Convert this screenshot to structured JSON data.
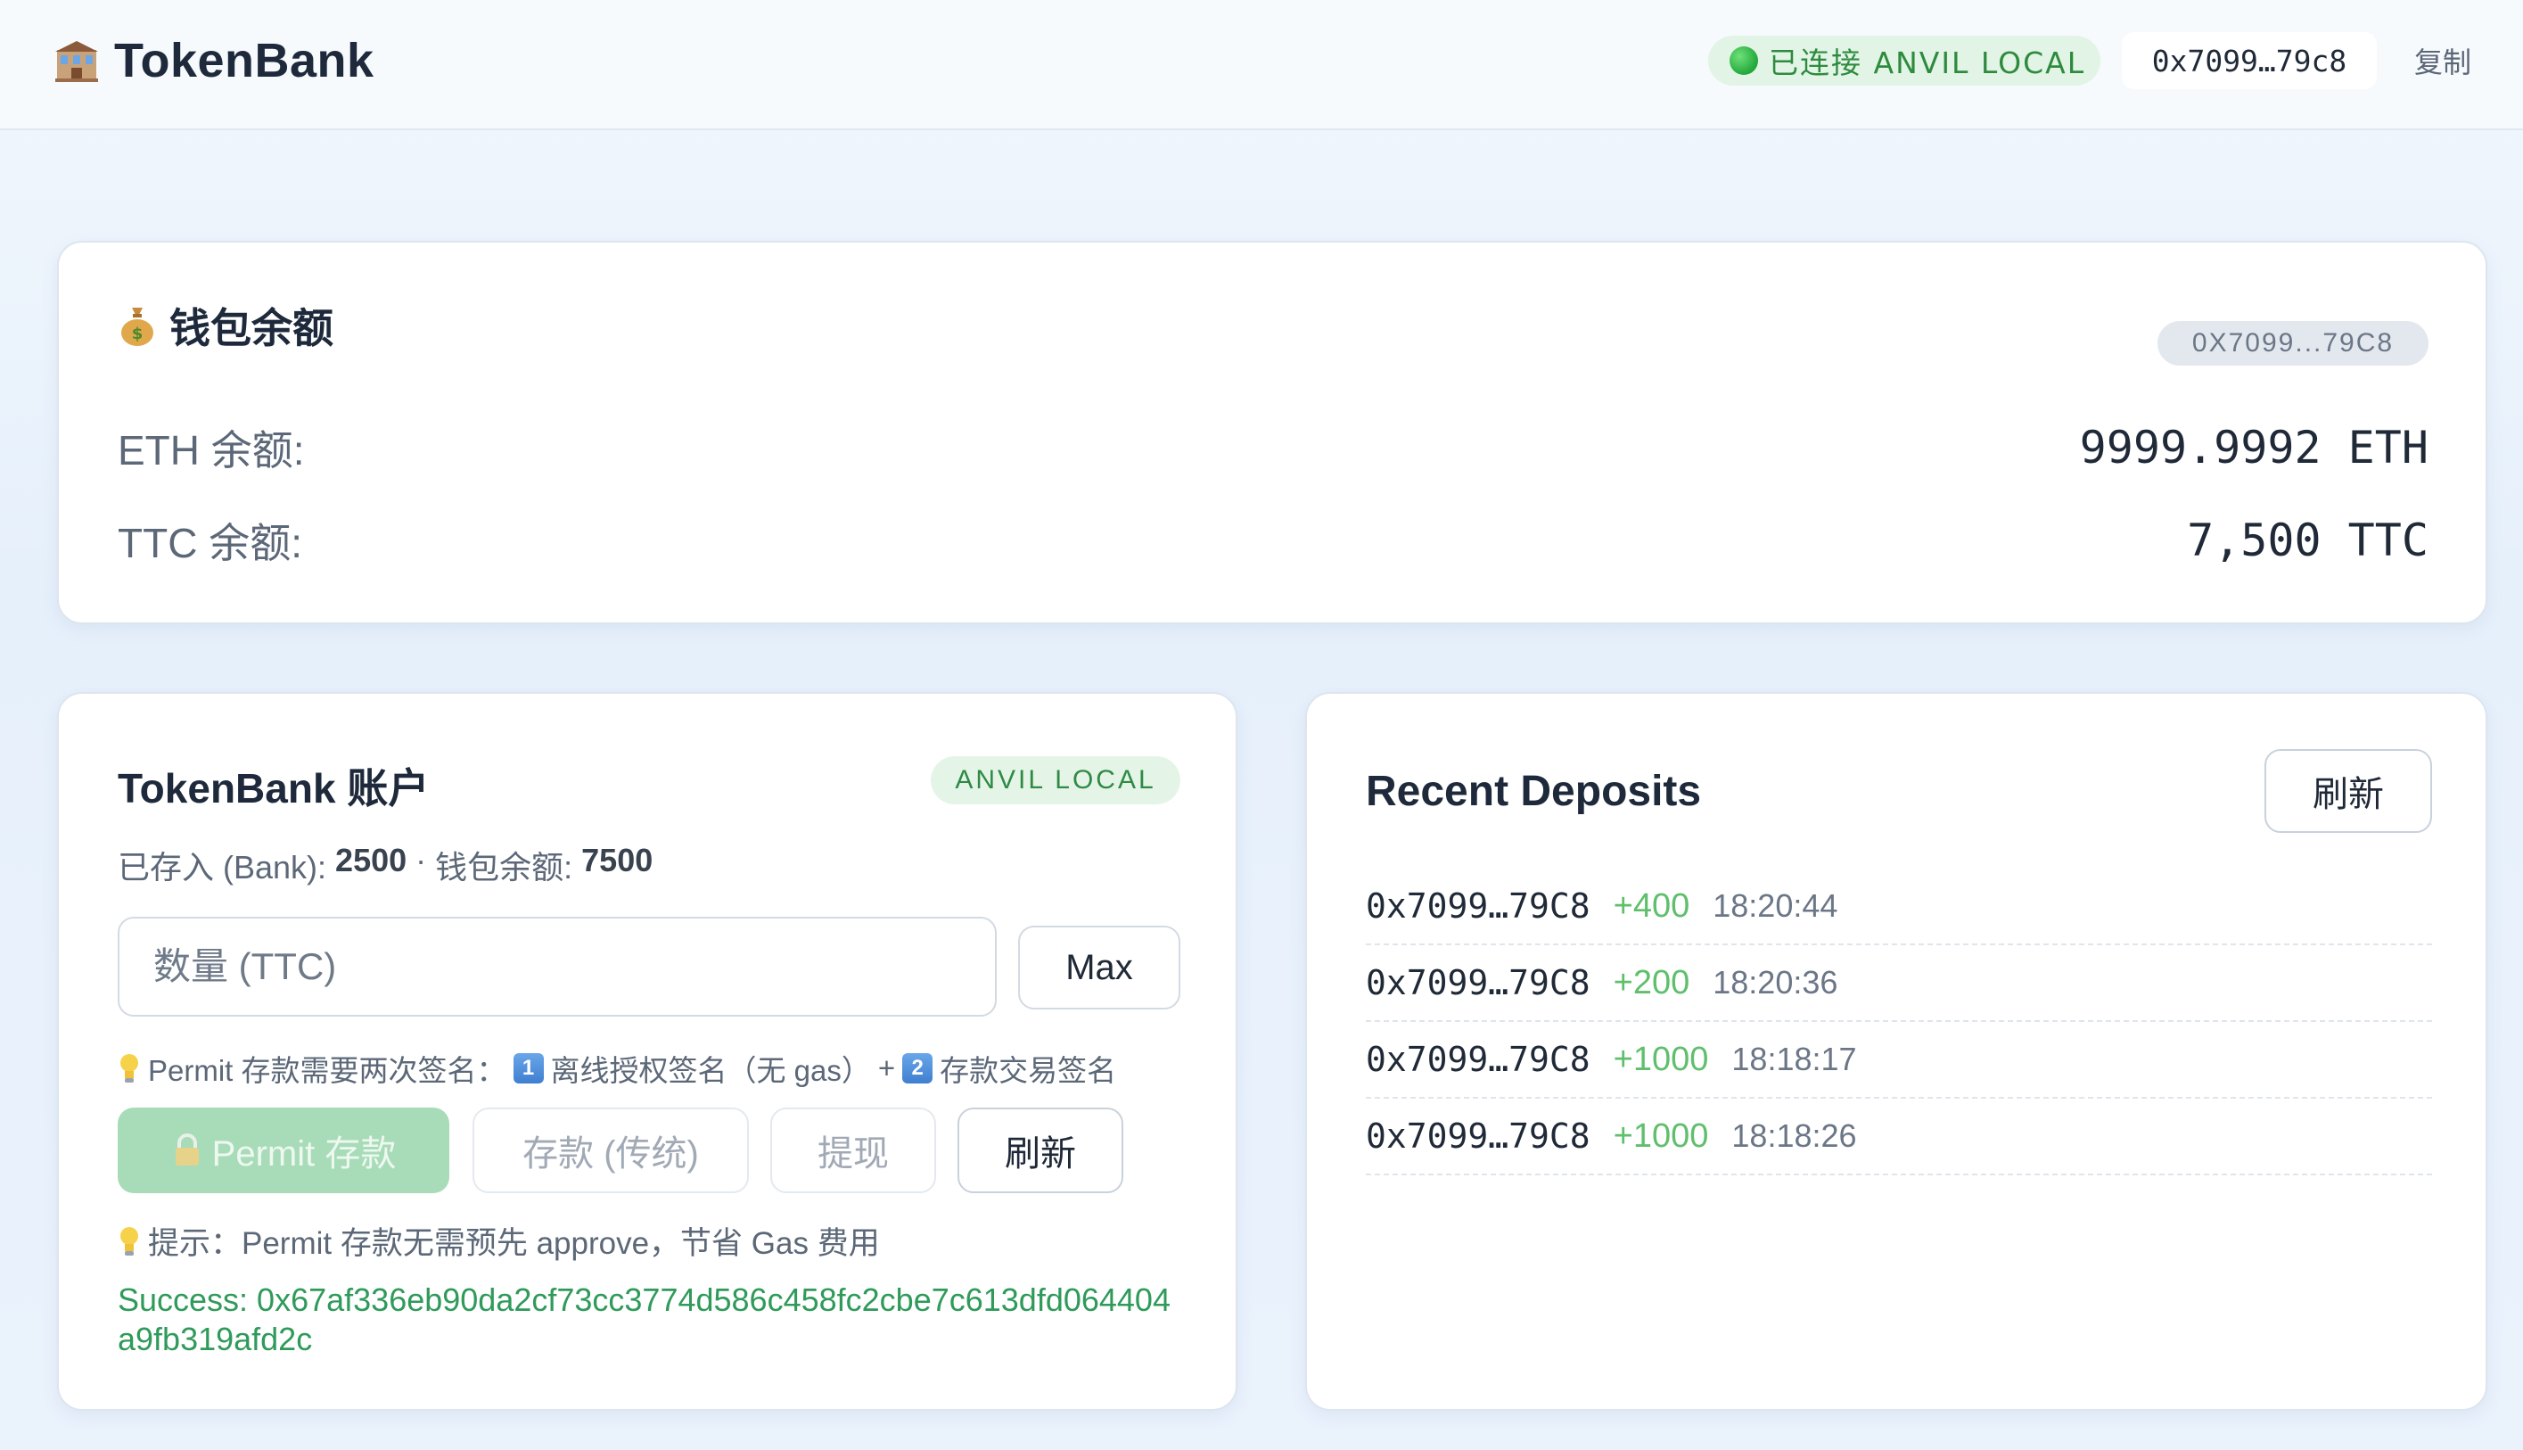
{
  "header": {
    "app_title": "TokenBank",
    "network_status": "已连接 ANVIL LOCAL",
    "address": "0x7099…79c8",
    "copy_label": "复制"
  },
  "wallet": {
    "title": "钱包余额",
    "address_chip": "0X7099...79C8",
    "eth_label": "ETH 余额:",
    "eth_value": "9999.9992 ETH",
    "ttc_label": "TTC 余额:",
    "ttc_value": "7,500 TTC"
  },
  "account": {
    "title": "TokenBank 账户",
    "network_chip": "ANVIL LOCAL",
    "deposited_label": "已存入 (Bank):",
    "deposited_value": "2500",
    "separator": "·",
    "wallet_label": "钱包余额:",
    "wallet_value": "7500",
    "amount_placeholder": "数量 (TTC)",
    "max_label": "Max",
    "permit_hint_prefix": "Permit 存款需要两次签名：",
    "permit_hint_step1_num": "1",
    "permit_hint_step1": "离线授权签名（无 gas）",
    "permit_hint_plus": "+",
    "permit_hint_step2_num": "2",
    "permit_hint_step2": "存款交易签名",
    "permit_button": "Permit 存款",
    "legacy_button": "存款 (传统)",
    "withdraw_button": "提现",
    "refresh_button": "刷新",
    "tip": "提示：Permit 存款无需预先 approve，节省 Gas 费用",
    "success_message": "Success: 0x67af336eb90da2cf73cc3774d586c458fc2cbe7c613dfd064404a9fb319afd2c"
  },
  "deposits": {
    "title": "Recent Deposits",
    "refresh_button": "刷新",
    "rows": [
      {
        "address": "0x7099…79C8",
        "amount": "+400",
        "time": "18:20:44"
      },
      {
        "address": "0x7099…79C8",
        "amount": "+200",
        "time": "18:20:36"
      },
      {
        "address": "0x7099…79C8",
        "amount": "+1000",
        "time": "18:18:17"
      },
      {
        "address": "0x7099…79C8",
        "amount": "+1000",
        "time": "18:18:26"
      }
    ]
  },
  "icons": {
    "brand": "bank-icon",
    "wallet": "money-bag-icon",
    "hint": "lightbulb-icon",
    "permit": "lock-icon"
  },
  "colors": {
    "accent_green": "#2e8b3e",
    "success_text": "#2f9a5a",
    "deposit_amount": "#5fbf6c",
    "permit_button_bg": "#a8dcb8"
  }
}
